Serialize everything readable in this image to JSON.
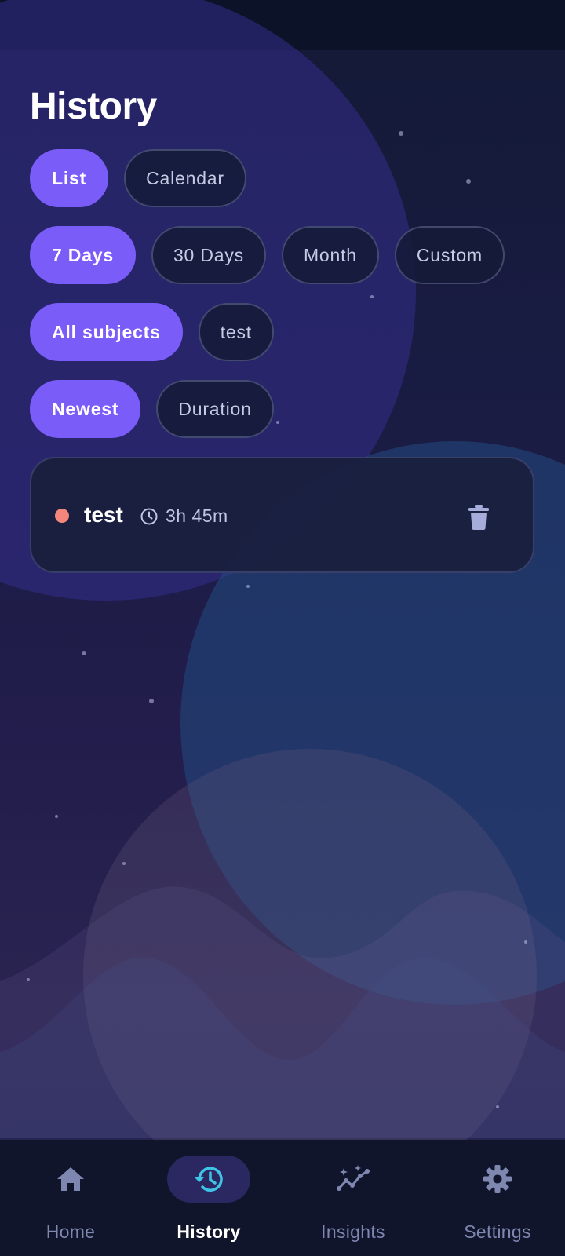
{
  "page": {
    "title": "History"
  },
  "view_toggle": {
    "options": [
      "List",
      "Calendar"
    ],
    "selected": "List"
  },
  "range_filter": {
    "options": [
      "7 Days",
      "30 Days",
      "Month",
      "Custom"
    ],
    "selected": "7 Days"
  },
  "subject_filter": {
    "options": [
      "All subjects",
      "test"
    ],
    "selected": "All subjects"
  },
  "sort_filter": {
    "options": [
      "Newest",
      "Duration"
    ],
    "selected": "Newest"
  },
  "sessions": [
    {
      "subject": "test",
      "duration": "3h 45m",
      "color": "#f4867c",
      "icons": [
        "clock-icon",
        "trash-icon"
      ]
    }
  ],
  "nav": {
    "items": [
      {
        "label": "Home",
        "icon": "home-icon"
      },
      {
        "label": "History",
        "icon": "history-icon"
      },
      {
        "label": "Insights",
        "icon": "insights-icon"
      },
      {
        "label": "Settings",
        "icon": "gear-icon"
      }
    ],
    "active": "History"
  },
  "colors": {
    "accent": "#7a5cf8",
    "history_icon": "#3fc3e6",
    "nav_inactive": "#7e87b0"
  }
}
